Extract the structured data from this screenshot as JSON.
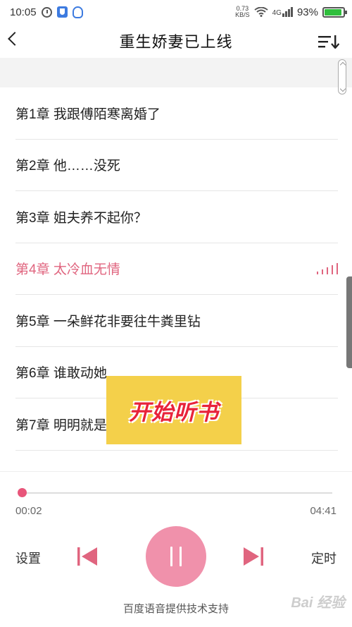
{
  "status_bar": {
    "time": "10:05",
    "net_speed_value": "0.73",
    "net_speed_unit": "KB/S",
    "signal_label": "4G",
    "battery_percent": "93%",
    "battery_level": 0.93
  },
  "header": {
    "title": "重生娇妻已上线"
  },
  "chapters": [
    {
      "label": "第1章  我跟傅陌寒离婚了"
    },
    {
      "label": "第2章  他……没死"
    },
    {
      "label": "第3章  姐夫养不起你？"
    },
    {
      "label": "第4章  太冷血无情",
      "playing": true
    },
    {
      "label": "第5章  一朵鲜花非要往牛粪里钻"
    },
    {
      "label": "第6章  谁敢动她"
    },
    {
      "label": "第7章  明明就是"
    }
  ],
  "overlay": {
    "text": "开始听书"
  },
  "player": {
    "current_time": "00:02",
    "total_time": "04:41",
    "progress": 0.007,
    "settings_label": "设置",
    "timer_label": "定时"
  },
  "footer": {
    "text": "百度语音提供技术支持",
    "watermark": "Bai 经验"
  },
  "colors": {
    "accent": "#e0657f",
    "play_button": "#f091ab",
    "sticker_bg": "#f4d04a",
    "sticker_text": "#e8233a"
  }
}
